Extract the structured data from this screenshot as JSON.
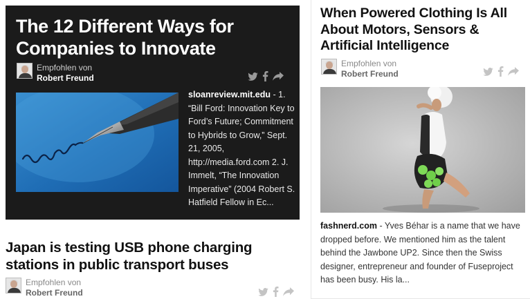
{
  "cards": [
    {
      "title": "The 12 Different Ways for Companies to Innovate",
      "recommended_label": "Empfohlen von",
      "recommender": "Robert Freund",
      "source": "sloanreview.mit.edu",
      "excerpt": " - 1. “Bill Ford: Innovation Key to Ford’s Future; Commitment to Hybrids to Grow,” Sept. 21, 2005, http://media.ford.com 2. J. Immelt, “The Innovation Imperative” (2004 Robert S. Hatfield Fellow in Ec...",
      "image": "fountain-pen-writing-on-blue"
    },
    {
      "title": "Japan is testing USB phone charging stations in public transport buses",
      "recommended_label": "Empfohlen von",
      "recommender": "Robert Freund"
    },
    {
      "title": "When Powered Clothing Is All About Motors, Sensors & Artificial Intelligence",
      "recommended_label": "Empfohlen von",
      "recommender": "Robert Freund",
      "source": "fashnerd.com",
      "excerpt": " - Yves Béhar is a name that we have dropped before. We mentioned him as the talent behind the Jawbone UP2. Since then the Swiss designer, entrepreneur and founder of Fuseproject has been busy. His la...",
      "image": "powered-clothing-model"
    }
  ],
  "colors": {
    "dark_card_bg": "#1b1b1b",
    "share_icon_dark": "#9a9a9a",
    "share_icon_light": "#c4c4c4"
  },
  "icons": [
    "twitter-icon",
    "facebook-icon",
    "share-arrow-icon"
  ]
}
